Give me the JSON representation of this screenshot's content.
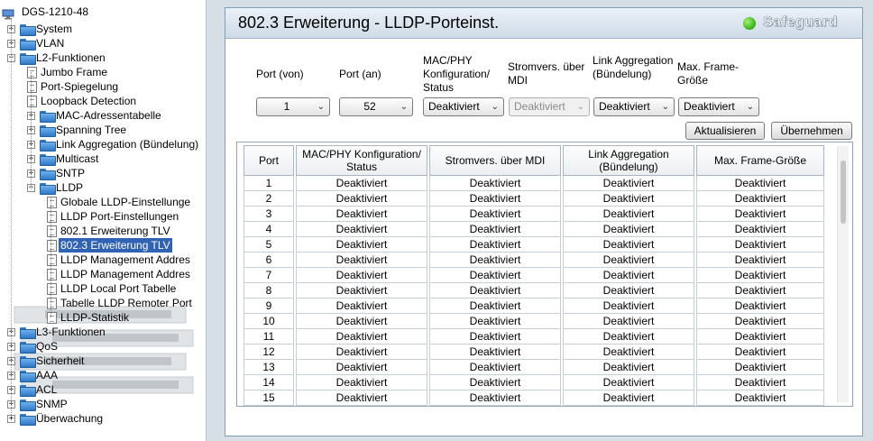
{
  "tree": {
    "root_label": "DGS-1210-48",
    "nodes": [
      {
        "label": "System",
        "type": "folder",
        "expander": "+"
      },
      {
        "label": "VLAN",
        "type": "folder",
        "expander": "+"
      },
      {
        "label": "L2-Funktionen",
        "type": "folder",
        "expander": "-"
      },
      {
        "label": "Jumbo Frame",
        "type": "page"
      },
      {
        "label": "Port-Spiegelung",
        "type": "page"
      },
      {
        "label": "Loopback Detection",
        "type": "page"
      },
      {
        "label": "MAC-Adressentabelle",
        "type": "folder",
        "expander": "+"
      },
      {
        "label": "Spanning Tree",
        "type": "folder",
        "expander": "+"
      },
      {
        "label": "Link Aggregation (Bündelung)",
        "type": "folder",
        "expander": "+"
      },
      {
        "label": "Multicast",
        "type": "folder",
        "expander": "+"
      },
      {
        "label": "SNTP",
        "type": "folder",
        "expander": "+"
      },
      {
        "label": "LLDP",
        "type": "folder",
        "expander": "-"
      },
      {
        "label": "Globale LLDP-Einstellunge",
        "type": "page"
      },
      {
        "label": "LLDP Port-Einstellungen",
        "type": "page"
      },
      {
        "label": "802.1 Erweiterung TLV",
        "type": "page"
      },
      {
        "label": "802.3 Erweiterung TLV",
        "type": "page",
        "selected": true
      },
      {
        "label": "LLDP Management Addres",
        "type": "page"
      },
      {
        "label": "LLDP Management Addres",
        "type": "page"
      },
      {
        "label": "LLDP Local Port Tabelle",
        "type": "page"
      },
      {
        "label": "Tabelle LLDP Remoter Port",
        "type": "page"
      },
      {
        "label": "LLDP-Statistik",
        "type": "page"
      },
      {
        "label": "L3-Funktionen",
        "type": "folder",
        "expander": "+"
      },
      {
        "label": "QoS",
        "type": "folder",
        "expander": "+"
      },
      {
        "label": "Sicherheit",
        "type": "folder",
        "expander": "+"
      },
      {
        "label": "AAA",
        "type": "folder",
        "expander": "+"
      },
      {
        "label": "ACL",
        "type": "folder",
        "expander": "+"
      },
      {
        "label": "SNMP",
        "type": "folder",
        "expander": "+"
      },
      {
        "label": "Überwachung",
        "type": "folder",
        "expander": "+"
      }
    ]
  },
  "panel": {
    "title": "802.3 Erweiterung - LLDP-Porteinst.",
    "safeguard": "Safeguard"
  },
  "form": {
    "port_from_label": "Port (von)",
    "port_to_label": "Port (an)",
    "macphy_label": "MAC/PHY Konfiguration/ Status",
    "power_label": "Stromvers. über MDI",
    "linkagg_label": "Link Aggregation (Bündelung)",
    "maxframe_label": "Max. Frame- Größe",
    "port_from_value": "1",
    "port_to_value": "52",
    "macphy_value": "Deaktiviert",
    "power_value": "Deaktiviert",
    "linkagg_value": "Deaktiviert",
    "maxframe_value": "Deaktiviert",
    "refresh_label": "Aktualisieren",
    "apply_label": "Übernehmen"
  },
  "table": {
    "headers": [
      "Port",
      "MAC/PHY Konfiguration/ Status",
      "Stromvers. über MDI",
      "Link Aggregation (Bündelung)",
      "Max. Frame-Größe"
    ],
    "rows": [
      [
        "1",
        "Deaktiviert",
        "Deaktiviert",
        "Deaktiviert",
        "Deaktiviert"
      ],
      [
        "2",
        "Deaktiviert",
        "Deaktiviert",
        "Deaktiviert",
        "Deaktiviert"
      ],
      [
        "3",
        "Deaktiviert",
        "Deaktiviert",
        "Deaktiviert",
        "Deaktiviert"
      ],
      [
        "4",
        "Deaktiviert",
        "Deaktiviert",
        "Deaktiviert",
        "Deaktiviert"
      ],
      [
        "5",
        "Deaktiviert",
        "Deaktiviert",
        "Deaktiviert",
        "Deaktiviert"
      ],
      [
        "6",
        "Deaktiviert",
        "Deaktiviert",
        "Deaktiviert",
        "Deaktiviert"
      ],
      [
        "7",
        "Deaktiviert",
        "Deaktiviert",
        "Deaktiviert",
        "Deaktiviert"
      ],
      [
        "8",
        "Deaktiviert",
        "Deaktiviert",
        "Deaktiviert",
        "Deaktiviert"
      ],
      [
        "9",
        "Deaktiviert",
        "Deaktiviert",
        "Deaktiviert",
        "Deaktiviert"
      ],
      [
        "10",
        "Deaktiviert",
        "Deaktiviert",
        "Deaktiviert",
        "Deaktiviert"
      ],
      [
        "11",
        "Deaktiviert",
        "Deaktiviert",
        "Deaktiviert",
        "Deaktiviert"
      ],
      [
        "12",
        "Deaktiviert",
        "Deaktiviert",
        "Deaktiviert",
        "Deaktiviert"
      ],
      [
        "13",
        "Deaktiviert",
        "Deaktiviert",
        "Deaktiviert",
        "Deaktiviert"
      ],
      [
        "14",
        "Deaktiviert",
        "Deaktiviert",
        "Deaktiviert",
        "Deaktiviert"
      ],
      [
        "15",
        "Deaktiviert",
        "Deaktiviert",
        "Deaktiviert",
        "Deaktiviert"
      ]
    ]
  },
  "colors": {
    "selection": "#3163b5",
    "safeguard_on": "#2fb011",
    "page_bg": "#d6dee6"
  }
}
